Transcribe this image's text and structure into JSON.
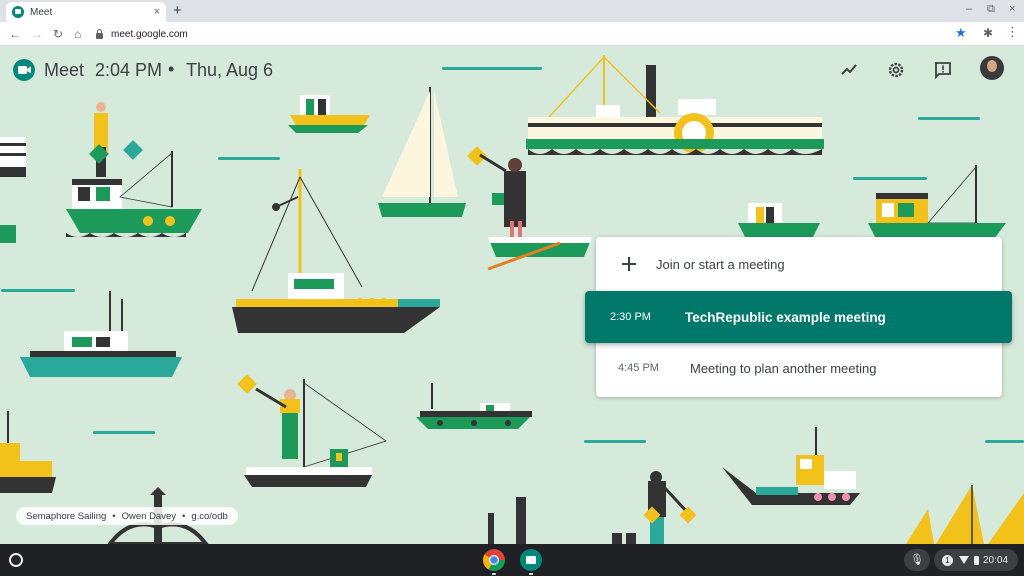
{
  "browser": {
    "tab_title": "Meet",
    "tab_close": "×",
    "new_tab": "+",
    "url": "meet.google.com",
    "window_controls": [
      "–",
      "⧉",
      "×"
    ]
  },
  "header": {
    "app_name": "Meet",
    "time": "2:04 PM",
    "separator": "•",
    "date": "Thu, Aug 6"
  },
  "meetings": {
    "join_label": "Join or start a meeting",
    "items": [
      {
        "time": "2:30 PM",
        "title": "TechRepublic example meeting"
      },
      {
        "time": "4:45 PM",
        "title": "Meeting to plan another meeting"
      }
    ]
  },
  "credit": {
    "title": "Semaphore Sailing",
    "artist": "Owen Davey",
    "link": "g.co/odb",
    "sep": "•"
  },
  "shelf": {
    "notification_count": "1",
    "clock": "20:04"
  },
  "colors": {
    "background": "#d6eadb",
    "accent": "#00796b",
    "boat_green": "#1b9a59",
    "boat_yellow": "#f2c21b"
  }
}
